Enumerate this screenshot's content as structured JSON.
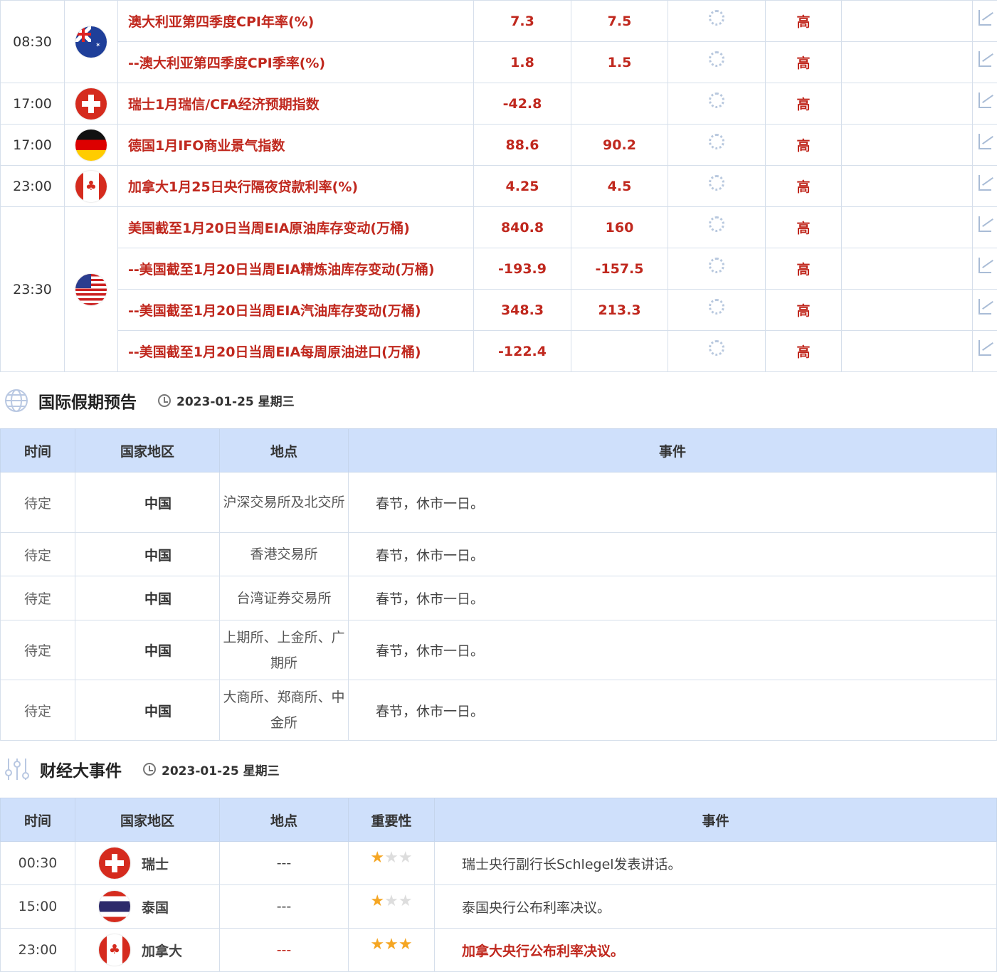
{
  "calendar": {
    "rows": [
      {
        "time": "08:30",
        "flag": "australia",
        "rowspan": 2,
        "event": "澳大利亚第四季度CPI年率(%)",
        "prev": "7.3",
        "forecast": "7.5",
        "importance": "高"
      },
      {
        "event": "--澳大利亚第四季度CPI季率(%)",
        "prev": "1.8",
        "forecast": "1.5",
        "importance": "高"
      },
      {
        "time": "17:00",
        "flag": "switzerland",
        "rowspan": 1,
        "event": "瑞士1月瑞信/CFA经济预期指数",
        "prev": "-42.8",
        "forecast": "",
        "importance": "高"
      },
      {
        "time": "17:00",
        "flag": "germany",
        "rowspan": 1,
        "event": "德国1月IFO商业景气指数",
        "prev": "88.6",
        "forecast": "90.2",
        "importance": "高"
      },
      {
        "time": "23:00",
        "flag": "canada",
        "rowspan": 1,
        "event": "加拿大1月25日央行隔夜贷款利率(%)",
        "prev": "4.25",
        "forecast": "4.5",
        "importance": "高"
      },
      {
        "time": "23:30",
        "flag": "usa",
        "rowspan": 4,
        "event": "美国截至1月20日当周EIA原油库存变动(万桶)",
        "prev": "840.8",
        "forecast": "160",
        "importance": "高"
      },
      {
        "event": "--美国截至1月20日当周EIA精炼油库存变动(万桶)",
        "prev": "-193.9",
        "forecast": "-157.5",
        "importance": "高"
      },
      {
        "event": "--美国截至1月20日当周EIA汽油库存变动(万桶)",
        "prev": "348.3",
        "forecast": "213.3",
        "importance": "高"
      },
      {
        "event": "--美国截至1月20日当周EIA每周原油进口(万桶)",
        "prev": "-122.4",
        "forecast": "",
        "importance": "高"
      }
    ]
  },
  "holidays": {
    "title": "国际假期预告",
    "date": "2023-01-25 星期三",
    "headers": [
      "时间",
      "国家地区",
      "地点",
      "事件"
    ],
    "rows": [
      {
        "time": "待定",
        "country": "中国",
        "place": "沪深交易所及北交所",
        "event": "春节，休市一日。"
      },
      {
        "time": "待定",
        "country": "中国",
        "place": "香港交易所",
        "event": "春节，休市一日。"
      },
      {
        "time": "待定",
        "country": "中国",
        "place": "台湾证券交易所",
        "event": "春节，休市一日。"
      },
      {
        "time": "待定",
        "country": "中国",
        "place": "上期所、上金所、广期所",
        "event": "春节，休市一日。"
      },
      {
        "time": "待定",
        "country": "中国",
        "place": "大商所、郑商所、中金所",
        "event": "春节，休市一日。"
      }
    ]
  },
  "events": {
    "title": "财经大事件",
    "date": "2023-01-25 星期三",
    "headers": [
      "时间",
      "国家地区",
      "地点",
      "重要性",
      "事件"
    ],
    "rows": [
      {
        "time": "00:30",
        "flag": "switzerland",
        "country": "瑞士",
        "place": "---",
        "stars": 1,
        "event": "瑞士央行副行长Schlegel发表讲话。",
        "highlight": false
      },
      {
        "time": "15:00",
        "flag": "thailand",
        "country": "泰国",
        "place": "---",
        "stars": 1,
        "event": "泰国央行公布利率决议。",
        "highlight": false
      },
      {
        "time": "23:00",
        "flag": "canada",
        "country": "加拿大",
        "place": "---",
        "stars": 3,
        "event": "加拿大央行公布利率决议。",
        "highlight": true
      }
    ]
  },
  "colors": {
    "accent_red": "#c0281e",
    "header_bg": "#cfe0fb",
    "star": "#f5a623"
  }
}
